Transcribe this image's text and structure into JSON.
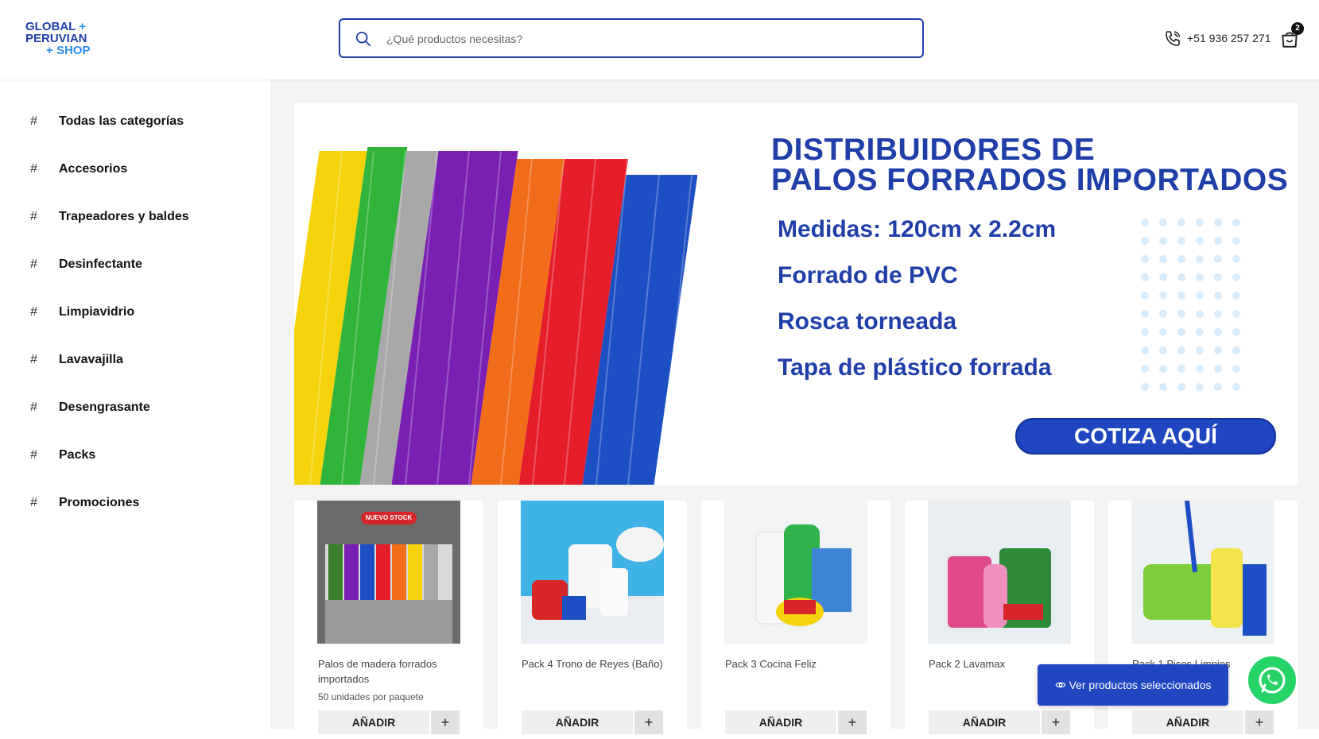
{
  "header": {
    "logo": {
      "line1": "GLOBAL",
      "line2": "PERUVIAN",
      "line3": "SHOP",
      "plus": "+"
    },
    "search": {
      "placeholder": "¿Qué productos necesitas?",
      "value": ""
    },
    "phone": "+51 936 257 271",
    "cart_count": "2"
  },
  "sidebar": {
    "items": [
      {
        "label": "Todas las categorías"
      },
      {
        "label": "Accesorios"
      },
      {
        "label": "Trapeadores y baldes"
      },
      {
        "label": "Desinfectante"
      },
      {
        "label": "Limpiavidrio"
      },
      {
        "label": "Lavavajilla"
      },
      {
        "label": "Desengrasante"
      },
      {
        "label": "Packs"
      },
      {
        "label": "Promociones"
      }
    ],
    "hash": "#"
  },
  "banner": {
    "heading_line1": "DISTRIBUIDORES DE",
    "heading_line2": "PALOS FORRADOS IMPORTADOS",
    "features": [
      "Medidas: 120cm x 2.2cm",
      "Forrado de PVC",
      "Rosca torneada",
      "Tapa de plástico forrada"
    ],
    "cta": "COTIZA AQUÍ"
  },
  "products": [
    {
      "title": "Palos de madera forrados importados",
      "subtitle": "50 unidades por paquete",
      "badge": "NUEVO STOCK",
      "add_label": "AÑADIR",
      "plus": "+"
    },
    {
      "title": "Pack 4 Trono de Reyes (Baño)",
      "subtitle": "",
      "add_label": "AÑADIR",
      "plus": "+"
    },
    {
      "title": "Pack 3 Cocina Feliz",
      "subtitle": "",
      "add_label": "AÑADIR",
      "plus": "+"
    },
    {
      "title": "Pack 2 Lavamax",
      "subtitle": "",
      "add_label": "AÑADIR",
      "plus": "+"
    },
    {
      "title": "Pack 1 Pisos Limpios",
      "subtitle": "",
      "add_label": "AÑADIR",
      "plus": "+"
    }
  ],
  "floating_button": {
    "label": "Ver productos seleccionados"
  },
  "colors": {
    "brand": "#1f3ea8",
    "accent": "#1f45c0",
    "whatsapp": "#25d366"
  },
  "icons": [
    "search-icon",
    "phone-icon",
    "cart-icon",
    "eye-icon",
    "whatsapp-icon"
  ]
}
